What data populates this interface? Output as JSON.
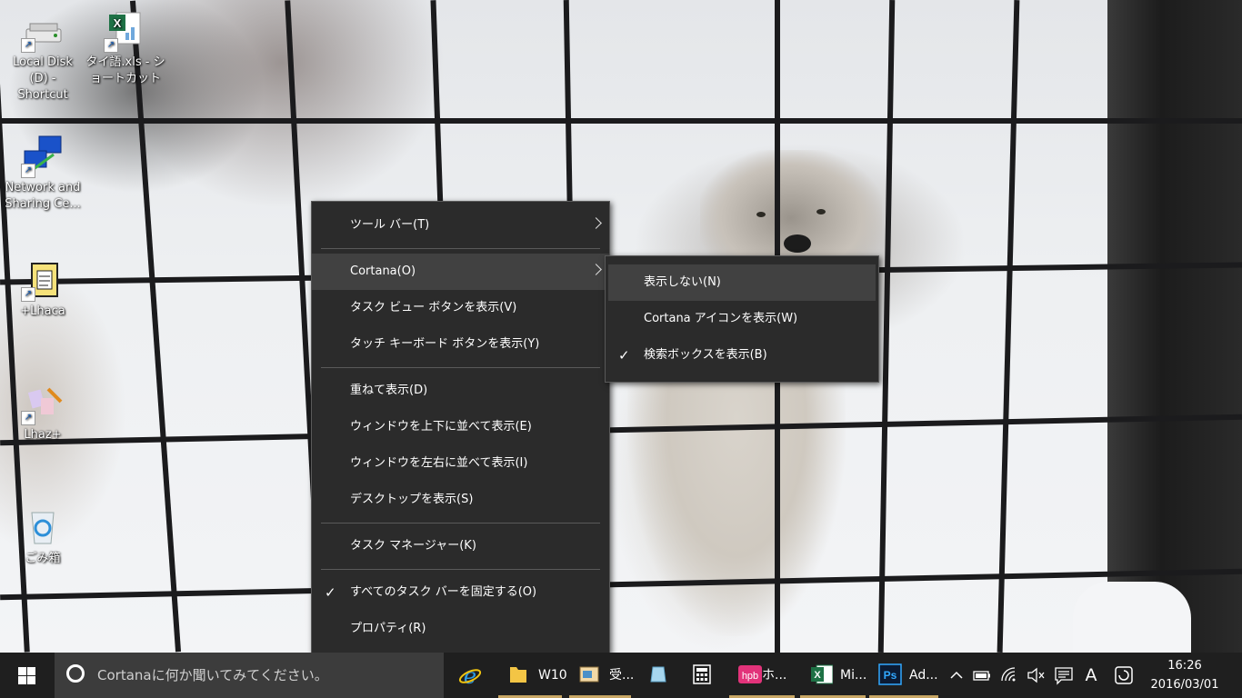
{
  "desktop": {
    "icons": [
      {
        "label": "Local Disk (D) - Shortcut",
        "icon": "drive-icon"
      },
      {
        "label": "タイ語.xls - ショートカット",
        "icon": "excel-file-icon"
      },
      {
        "label": "Network and Sharing Ce...",
        "icon": "network-icon"
      },
      {
        "label": "+Lhaca",
        "icon": "lhaca-icon"
      },
      {
        "label": "Lhaz+",
        "icon": "lhaz-icon"
      },
      {
        "label": "ごみ箱",
        "icon": "recycle-bin-icon"
      }
    ]
  },
  "context_menu": {
    "items": [
      {
        "label": "ツール バー(T)",
        "submenu": true
      },
      {
        "label": "Cortana(O)",
        "submenu": true,
        "highlighted": true
      },
      {
        "label": "タスク ビュー ボタンを表示(V)"
      },
      {
        "label": "タッチ キーボード ボタンを表示(Y)"
      },
      {
        "label": "重ねて表示(D)"
      },
      {
        "label": "ウィンドウを上下に並べて表示(E)"
      },
      {
        "label": "ウィンドウを左右に並べて表示(I)"
      },
      {
        "label": "デスクトップを表示(S)"
      },
      {
        "label": "タスク マネージャー(K)"
      },
      {
        "label": "すべてのタスク バーを固定する(O)",
        "checked": true
      },
      {
        "label": "プロパティ(R)"
      }
    ],
    "check_glyph": "✓"
  },
  "cortana_submenu": {
    "items": [
      {
        "label": "表示しない(N)",
        "highlighted": true
      },
      {
        "label": "Cortana アイコンを表示(W)"
      },
      {
        "label": "検索ボックスを表示(B)",
        "checked": true
      }
    ]
  },
  "taskbar": {
    "search_placeholder": "Cortanaに何か聞いてみてください。",
    "apps": [
      {
        "label": "",
        "icon": "internet-explorer-icon"
      },
      {
        "label": "W10",
        "icon": "file-explorer-icon"
      },
      {
        "label": "受...",
        "icon": "mail-app-icon"
      },
      {
        "label": "",
        "icon": "glass-app-icon"
      },
      {
        "label": "",
        "icon": "calculator-icon"
      },
      {
        "label": "ホ...",
        "icon": "hpb-icon"
      },
      {
        "label": "Mi...",
        "icon": "excel-icon"
      },
      {
        "label": "Ad...",
        "icon": "photoshop-icon"
      }
    ],
    "tray": {
      "ime_indicator": "A",
      "time": "16:26",
      "date": "2016/03/01"
    }
  },
  "colors": {
    "menu_bg": "#2b2b2b",
    "menu_highlight": "#414141",
    "taskbar_bg": "#1f1f1f",
    "search_bg": "#3c3c3c",
    "running_underline": "#c8a664"
  }
}
